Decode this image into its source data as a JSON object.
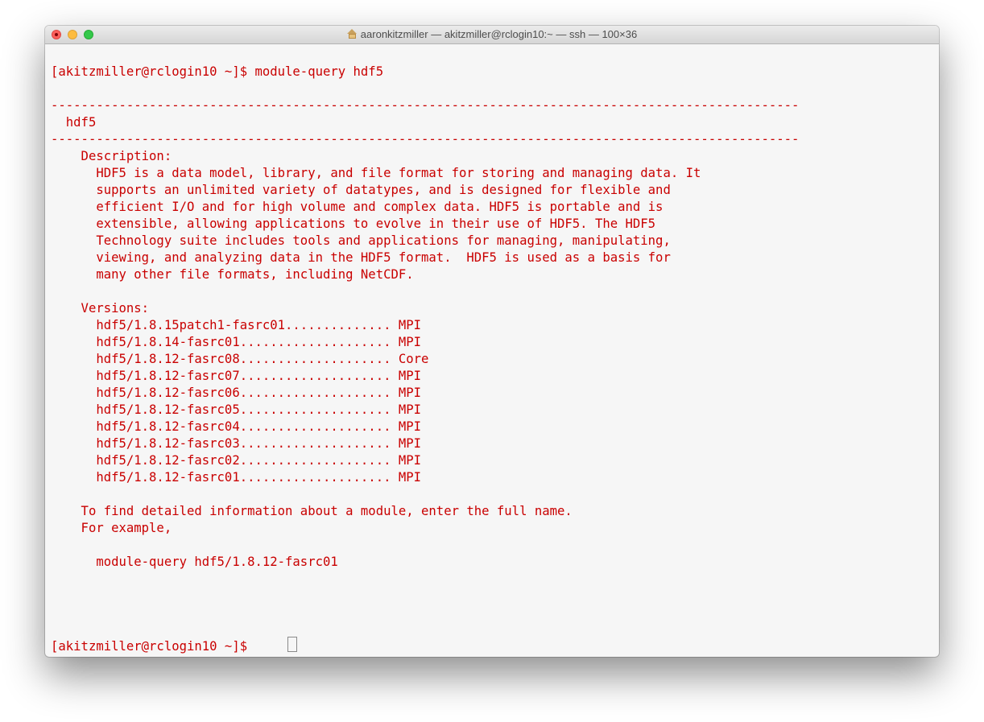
{
  "window": {
    "title": "aaronkitzmiller — akitzmiller@rclogin10:~ — ssh — 100×36"
  },
  "terminal": {
    "text_color": "#c90000",
    "background": "#f6f6f6",
    "lines": [
      "[akitzmiller@rclogin10 ~]$ module-query hdf5",
      "",
      "---------------------------------------------------------------------------------------------------",
      "  hdf5",
      "---------------------------------------------------------------------------------------------------",
      "    Description:",
      "      HDF5 is a data model, library, and file format for storing and managing data. It",
      "      supports an unlimited variety of datatypes, and is designed for flexible and",
      "      efficient I/O and for high volume and complex data. HDF5 is portable and is",
      "      extensible, allowing applications to evolve in their use of HDF5. The HDF5",
      "      Technology suite includes tools and applications for managing, manipulating,",
      "      viewing, and analyzing data in the HDF5 format.  HDF5 is used as a basis for",
      "      many other file formats, including NetCDF.",
      "",
      "    Versions:",
      "      hdf5/1.8.15patch1-fasrc01.............. MPI",
      "      hdf5/1.8.14-fasrc01.................... MPI",
      "      hdf5/1.8.12-fasrc08.................... Core",
      "      hdf5/1.8.12-fasrc07.................... MPI",
      "      hdf5/1.8.12-fasrc06.................... MPI",
      "      hdf5/1.8.12-fasrc05.................... MPI",
      "      hdf5/1.8.12-fasrc04.................... MPI",
      "      hdf5/1.8.12-fasrc03.................... MPI",
      "      hdf5/1.8.12-fasrc02.................... MPI",
      "      hdf5/1.8.12-fasrc01.................... MPI",
      "",
      "    To find detailed information about a module, enter the full name.",
      "    For example,",
      "",
      "      module-query hdf5/1.8.12-fasrc01",
      "",
      "",
      "",
      "",
      "[akitzmiller@rclogin10 ~]$ "
    ]
  }
}
